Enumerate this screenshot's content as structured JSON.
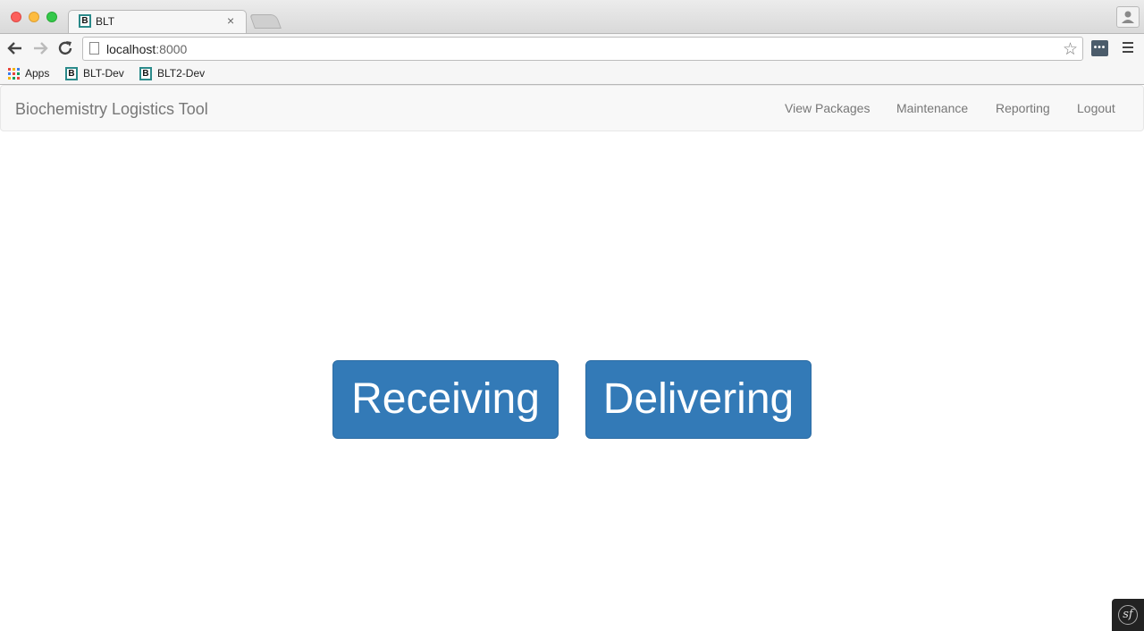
{
  "browser": {
    "tab": {
      "title": "BLT",
      "favicon_letter": "B",
      "close_symbol": "×"
    },
    "address_bar": {
      "host": "localhost",
      "port": ":8000"
    },
    "bookmarks": [
      {
        "label": "Apps",
        "icon": "apps-grid-icon"
      },
      {
        "label": "BLT-Dev",
        "icon": "B"
      },
      {
        "label": "BLT2-Dev",
        "icon": "B"
      }
    ],
    "ext_label": "•••"
  },
  "navbar": {
    "brand": "Biochemistry Logistics Tool",
    "links": [
      "View Packages",
      "Maintenance",
      "Reporting",
      "Logout"
    ]
  },
  "main": {
    "receiving_label": "Receiving",
    "delivering_label": "Delivering"
  },
  "debug_toolbar": {
    "logo": "sf"
  },
  "colors": {
    "primary_button": "#337ab7",
    "navbar_bg": "#f8f8f8",
    "nav_text": "#777777"
  }
}
